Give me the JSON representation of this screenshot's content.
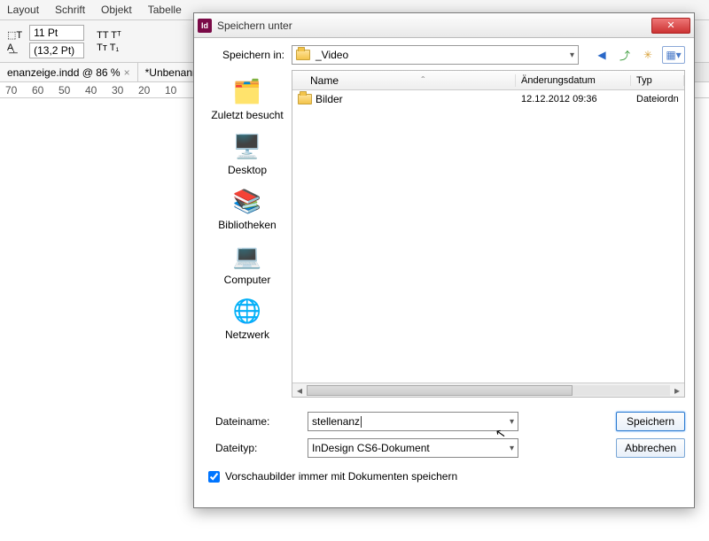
{
  "menubar": [
    "Layout",
    "Schrift",
    "Objekt",
    "Tabelle"
  ],
  "toolbar": {
    "font_size": "11 Pt",
    "leading": "(13,2 Pt)"
  },
  "tabs": [
    {
      "label": "enanzeige.indd @ 86 %",
      "close": "×"
    },
    {
      "label": "*Unbenannt-",
      "close": ""
    }
  ],
  "ruler_marks": [
    "70",
    "60",
    "50",
    "40",
    "30",
    "20",
    "10"
  ],
  "dialog": {
    "title": "Speichern unter",
    "app_icon_text": "Id",
    "save_in_label": "Speichern in:",
    "save_in_value": "_Video",
    "sidebar": [
      {
        "label": "Zuletzt besucht",
        "icon": "🗂️"
      },
      {
        "label": "Desktop",
        "icon": "🖥️"
      },
      {
        "label": "Bibliotheken",
        "icon": "📚"
      },
      {
        "label": "Computer",
        "icon": "💻"
      },
      {
        "label": "Netzwerk",
        "icon": "🌐"
      }
    ],
    "columns": {
      "name": "Name",
      "date": "Änderungsdatum",
      "type": "Typ"
    },
    "rows": [
      {
        "name": "Bilder",
        "date": "12.12.2012 09:36",
        "type": "Dateiordn"
      }
    ],
    "filename_label": "Dateiname:",
    "filename_value": "stellenanz",
    "filetype_label": "Dateityp:",
    "filetype_value": "InDesign CS6-Dokument",
    "save_button": "Speichern",
    "cancel_button": "Abbrechen",
    "checkbox_label": "Vorschaubilder immer mit Dokumenten speichern",
    "nav_icons": {
      "back": "⬅",
      "up": "⤴",
      "new_folder": "📁",
      "view": "▦"
    }
  }
}
